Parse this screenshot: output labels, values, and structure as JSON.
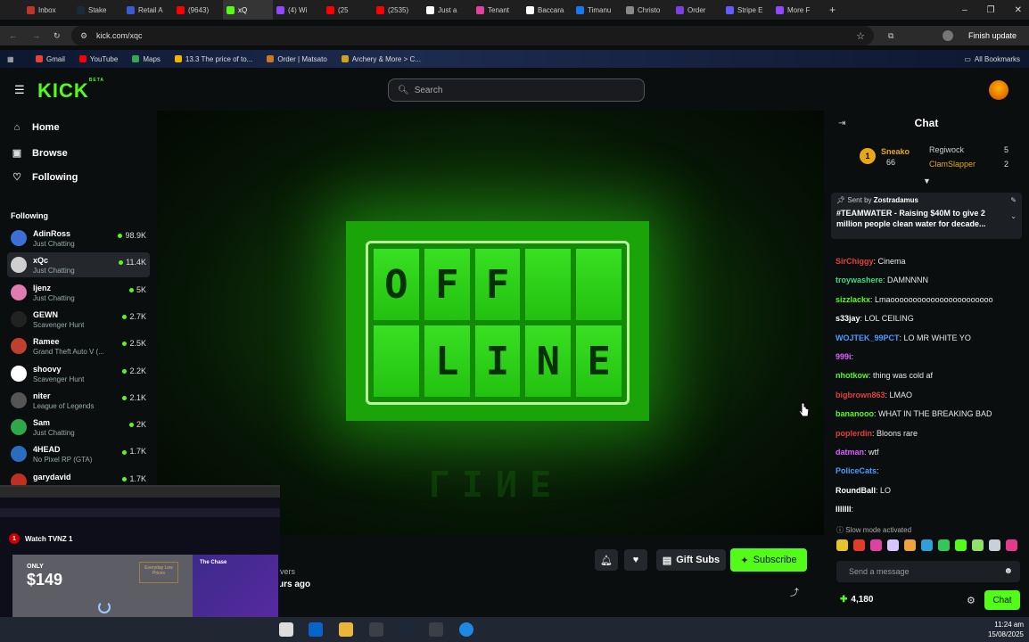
{
  "browser": {
    "tabs": [
      {
        "label": "Inbox",
        "color": "#c0352b"
      },
      {
        "label": "Stake",
        "color": "#1a2c38"
      },
      {
        "label": "Retail A",
        "color": "#3b5bd6"
      },
      {
        "label": "(9643)",
        "color": "#ff0000"
      },
      {
        "label": "xQ",
        "color": "#53fc18"
      },
      {
        "label": "(4) Wi",
        "color": "#9146ff"
      },
      {
        "label": "(25",
        "color": "#ff0000"
      },
      {
        "label": "(2535)",
        "color": "#ff0000"
      },
      {
        "label": "Just a",
        "color": "#ffffff"
      },
      {
        "label": "Tenant",
        "color": "#e040a0"
      },
      {
        "label": "Baccara",
        "color": "#ffffff"
      },
      {
        "label": "Timanu",
        "color": "#1877f2"
      },
      {
        "label": "Christo",
        "color": "#888888"
      },
      {
        "label": "Order",
        "color": "#7b3fe4"
      },
      {
        "label": "Stripe E",
        "color": "#635bff"
      },
      {
        "label": "More F",
        "color": "#9146ff"
      }
    ],
    "url": "kick.com/xqc",
    "finish_update": "Finish update",
    "bookmarks": [
      {
        "label": "Gmail",
        "color": "#ea4335"
      },
      {
        "label": "YouTube",
        "color": "#ff0000"
      },
      {
        "label": "Maps",
        "color": "#34a853"
      },
      {
        "label": "13.3 The price of to...",
        "color": "#f4b400"
      },
      {
        "label": "Order | Matsato",
        "color": "#cc7722"
      },
      {
        "label": "Archery & More > C...",
        "color": "#d4a017"
      }
    ],
    "all_bookmarks": "All Bookmarks"
  },
  "header": {
    "logo": "KICK",
    "logo_tag": "BETA",
    "search_placeholder": "Search"
  },
  "sidebar": {
    "nav": [
      {
        "label": "Home",
        "icon": "home-icon"
      },
      {
        "label": "Browse",
        "icon": "browse-icon"
      },
      {
        "label": "Following",
        "icon": "heart-icon"
      }
    ],
    "following_title": "Following",
    "channels": [
      {
        "name": "AdinRoss",
        "game": "Just Chatting",
        "viewers": "98.9K",
        "color": "#3b6fd6"
      },
      {
        "name": "xQc",
        "game": "Just Chatting",
        "viewers": "11.4K",
        "color": "#cfcfcf"
      },
      {
        "name": "ljenz",
        "game": "Just Chatting",
        "viewers": "5K",
        "color": "#e07ab0"
      },
      {
        "name": "GEWN",
        "game": "Scavenger Hunt",
        "viewers": "2.7K",
        "color": "#222222"
      },
      {
        "name": "Ramee",
        "game": "Grand Theft Auto V (...",
        "viewers": "2.5K",
        "color": "#c04030"
      },
      {
        "name": "shoovy",
        "game": "Scavenger Hunt",
        "viewers": "2.2K",
        "color": "#ffffff"
      },
      {
        "name": "niter",
        "game": "League of Legends",
        "viewers": "2.1K",
        "color": "#555555"
      },
      {
        "name": "Sam",
        "game": "Just Chatting",
        "viewers": "2K",
        "color": "#2ea84a"
      },
      {
        "name": "4HEAD",
        "game": "No Pixel RP (GTA)",
        "viewers": "1.7K",
        "color": "#2a6cc0"
      },
      {
        "name": "garydavid",
        "game": "",
        "viewers": "1.7K",
        "color": "#c03020"
      }
    ]
  },
  "player": {
    "row1": [
      "O",
      "F",
      "F",
      "",
      ""
    ],
    "row2": [
      "",
      "L",
      "I",
      "N",
      "E"
    ],
    "reflection": "LINE"
  },
  "stream_actions": {
    "gift_subs": "Gift Subs",
    "subscribe": "Subscribe",
    "viewers_fragment": "vers",
    "ago_fragment": "urs ago"
  },
  "pip": {
    "title": "Watch TVNZ 1",
    "badge": "1",
    "ad_only": "ONLY",
    "ad_price": "$149",
    "ad_banner": "Everyday Low Prices",
    "side_title": "The Chase"
  },
  "chat": {
    "title": "Chat",
    "leaderboard": [
      {
        "name": "Sneako",
        "value": "66",
        "rank": "1"
      },
      {
        "name": "Regiwock",
        "value": "5"
      },
      {
        "name": "ClamSlapper",
        "value": "2"
      }
    ],
    "pinned": {
      "sent_by": "Sent by",
      "author": "Zostradamus",
      "message": "#TEAMWATER - Raising $40M to give 2 million people clean water for decade..."
    },
    "messages": [
      {
        "user": "SirChiggy",
        "text": "Cinema",
        "color": "#e0403a"
      },
      {
        "user": "troywashere",
        "text": "DAMNNNN",
        "color": "#3ddc84"
      },
      {
        "user": "sizzlackx",
        "text": "Lmaooooooooooooooooooooooo",
        "color": "#53fc18"
      },
      {
        "user": "s33jay",
        "text": "LOL CEILING",
        "color": "#ffffff"
      },
      {
        "user": "WOJTEK_99PCT",
        "text": "LO MR WHITE YO",
        "color": "#4a9cff"
      },
      {
        "user": "999i",
        "text": "",
        "color": "#e05cff"
      },
      {
        "user": "nhotkow",
        "text": "thing was cold af",
        "color": "#53fc18"
      },
      {
        "user": "bigbrown863",
        "text": "LMAO",
        "color": "#e0403a"
      },
      {
        "user": "bananooo",
        "text": "WHAT IN THE BREAKING BAD",
        "color": "#53fc18"
      },
      {
        "user": "poplerdin",
        "text": "Bloons rare",
        "color": "#e0403a"
      },
      {
        "user": "datman",
        "text": "wtf",
        "color": "#e05cff"
      },
      {
        "user": "PoliceCats",
        "text": "",
        "color": "#4a9cff"
      },
      {
        "user": "RoundBall",
        "text": "LO",
        "color": "#ffffff"
      },
      {
        "user": "lllllll",
        "text": "",
        "color": "#ffffff"
      }
    ],
    "slow_mode": "Slow mode activated",
    "input_placeholder": "Send a message",
    "points": "4,180",
    "send_label": "Chat",
    "accent": "#53fc18"
  },
  "taskbar": {
    "time": "11:24 am",
    "date": "15/08/2025"
  }
}
